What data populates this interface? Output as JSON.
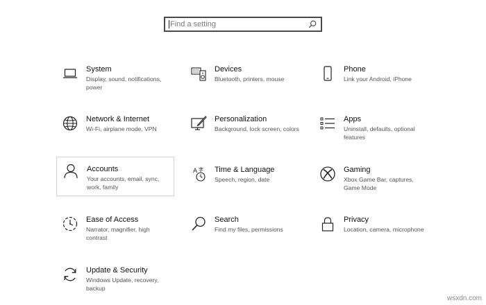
{
  "search": {
    "placeholder": "Find a setting"
  },
  "tiles": [
    {
      "title": "System",
      "desc": "Display, sound, notifications, power",
      "icon": "laptop-icon"
    },
    {
      "title": "Devices",
      "desc": "Bluetooth, printers, mouse",
      "icon": "keyboard-speaker-icon"
    },
    {
      "title": "Phone",
      "desc": "Link your Android, iPhone",
      "icon": "phone-icon"
    },
    {
      "title": "Network & Internet",
      "desc": "Wi-Fi, airplane mode, VPN",
      "icon": "globe-icon"
    },
    {
      "title": "Personalization",
      "desc": "Background, lock screen, colors",
      "icon": "pen-monitor-icon"
    },
    {
      "title": "Apps",
      "desc": "Uninstall, defaults, optional features",
      "icon": "apps-list-icon"
    },
    {
      "title": "Accounts",
      "desc": "Your accounts, email, sync, work, family",
      "icon": "person-icon"
    },
    {
      "title": "Time & Language",
      "desc": "Speech, region, date",
      "icon": "time-language-icon"
    },
    {
      "title": "Gaming",
      "desc": "Xbox Game Bar, captures, Game Mode",
      "icon": "xbox-icon"
    },
    {
      "title": "Ease of Access",
      "desc": "Narrator, magnifier, high contrast",
      "icon": "ease-of-access-icon"
    },
    {
      "title": "Search",
      "desc": "Find my files, permissions",
      "icon": "magnifier-icon"
    },
    {
      "title": "Privacy",
      "desc": "Location, camera, microphone",
      "icon": "lock-icon"
    },
    {
      "title": "Update & Security",
      "desc": "Windows Update, recovery, backup",
      "icon": "sync-arrows-icon"
    }
  ],
  "watermark": "wsxdn.com"
}
